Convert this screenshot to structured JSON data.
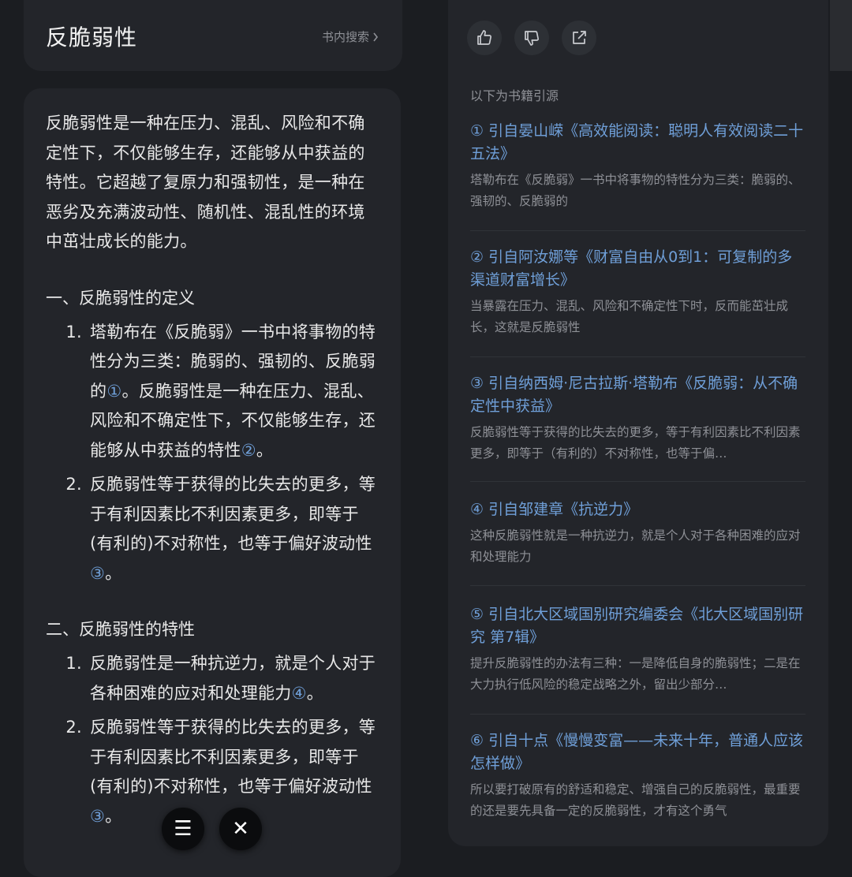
{
  "left": {
    "title": "反脆弱性",
    "search_link": "书内搜索",
    "intro": "反脆弱性是一种在压力、混乱、风险和不确定性下，不仅能够生存，还能够从中获益的特性。它超越了复原力和强韧性，是一种在恶劣及充满波动性、随机性、混乱性的环境中茁壮成长的能力。",
    "sections": [
      {
        "heading": "一、反脆弱性的定义",
        "items": [
          {
            "num": "1.",
            "parts": [
              "塔勒布在《反脆弱》一书中将事物的特性分为三类：脆弱的、强韧的、反脆弱的",
              "①",
              "。反脆弱性是一种在压力、混乱、风险和不确定性下，不仅能够生存，还能够从中获益的特性",
              "②",
              "。"
            ]
          },
          {
            "num": "2.",
            "parts": [
              "反脆弱性等于获得的比失去的更多，等于有利因素比不利因素更多，即等于(有利的)不对称性，也等于偏好波动性",
              "③",
              "。"
            ]
          }
        ]
      },
      {
        "heading": "二、反脆弱性的特性",
        "items": [
          {
            "num": "1.",
            "parts": [
              "反脆弱性是一种抗逆力，就是个人对于各种困难的应对和处理能力",
              "④",
              "。"
            ]
          },
          {
            "num": "2.",
            "parts": [
              "反脆弱性等于获得的比失去的更多，等于有利因素比不利因素更多，即等于(有利的)不对称性，也等于偏好波动性",
              "③",
              "。"
            ]
          }
        ]
      }
    ],
    "fab_menu": "☰",
    "fab_close": "✕"
  },
  "right": {
    "sources_title": "以下为书籍引源",
    "sources": [
      {
        "title": "① 引自晏山嵘《高效能阅读：聪明人有效阅读二十五法》",
        "snippet": "塔勒布在《反脆弱》一书中将事物的特性分为三类：脆弱的、强韧的、反脆弱的"
      },
      {
        "title": "② 引自阿汝娜等《财富自由从0到1：可复制的多渠道财富增长》",
        "snippet": "当暴露在压力、混乱、风险和不确定性下时，反而能茁壮成长，这就是反脆弱性"
      },
      {
        "title": "③ 引自纳西姆·尼古拉斯·塔勒布《反脆弱：从不确定性中获益》",
        "snippet": "反脆弱性等于获得的比失去的更多，等于有利因素比不利因素更多，即等于（有利的）不对称性，也等于偏…"
      },
      {
        "title": "④ 引自邹建章《抗逆力》",
        "snippet": "这种反脆弱性就是一种抗逆力，就是个人对于各种困难的应对和处理能力"
      },
      {
        "title": "⑤ 引自北大区域国别研究编委会《北大区域国别研究 第7辑》",
        "snippet": "提升反脆弱性的办法有三种：一是降低自身的脆弱性；二是在大力执行低风险的稳定战略之外，留出少部分…"
      },
      {
        "title": "⑥ 引自十点《慢慢变富——未来十年，普通人应该怎样做》",
        "snippet": "所以要打破原有的舒适和稳定、增强自己的反脆弱性，最重要的还是要先具备一定的反脆弱性，才有这个勇气"
      }
    ]
  },
  "colors": {
    "background": "#1b1d21",
    "card": "#23252a",
    "link": "#6f9fd8",
    "muted": "#8e9096"
  }
}
